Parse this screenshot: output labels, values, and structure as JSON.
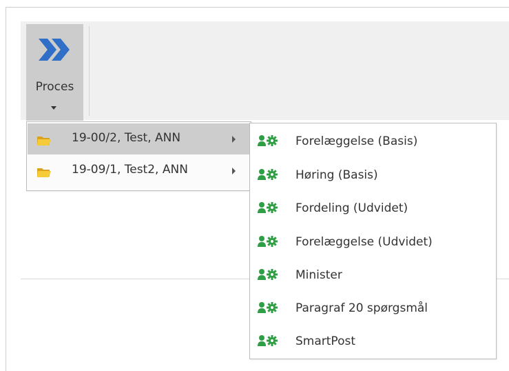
{
  "ribbon": {
    "proces_button": {
      "label": "Proces",
      "icon": "double-chevron-right-icon"
    }
  },
  "colors": {
    "chevron_blue": "#2f6fc7",
    "gear_green": "#2f9e44",
    "folder_yellow": "#f2c230",
    "highlight": "#cdcdcd"
  },
  "menu": {
    "items": [
      {
        "label": "19-00/2, Test, ANN",
        "icon": "folder-icon",
        "highlighted": true,
        "has_submenu": true
      },
      {
        "label": "19-09/1, Test2, ANN",
        "icon": "folder-icon",
        "highlighted": false,
        "has_submenu": true
      }
    ]
  },
  "submenu": {
    "icon": "user-gear-icon",
    "items": [
      {
        "label": "Forelæggelse (Basis)"
      },
      {
        "label": "Høring (Basis)"
      },
      {
        "label": "Fordeling (Udvidet)"
      },
      {
        "label": "Forelæggelse (Udvidet)"
      },
      {
        "label": "Minister"
      },
      {
        "label": "Paragraf 20 spørgsmål"
      },
      {
        "label": "SmartPost"
      }
    ]
  }
}
